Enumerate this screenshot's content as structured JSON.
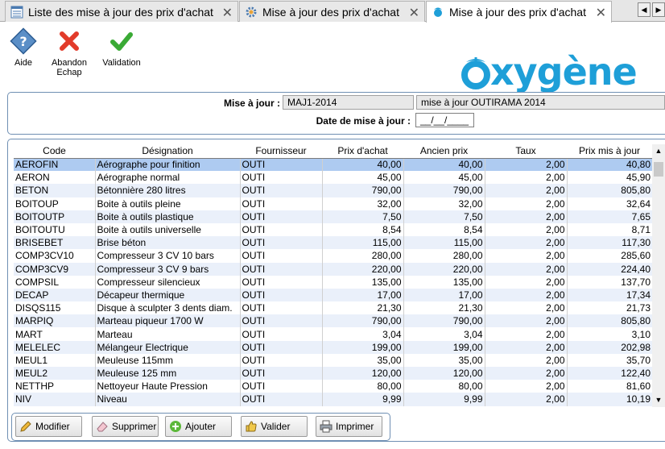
{
  "tabs": [
    {
      "label": "Liste des mise à jour des prix d'achat",
      "active": false,
      "icon": "list-icon"
    },
    {
      "label": "Mise à jour des prix d'achat",
      "active": false,
      "icon": "gear-icon"
    },
    {
      "label": "Mise à jour des prix d'achat",
      "active": true,
      "icon": "oxygene-icon"
    }
  ],
  "toolbar": {
    "aide": "Aide",
    "abandon_line1": "Abandon",
    "abandon_line2": "Echap",
    "validation": "Validation"
  },
  "logo": {
    "text": "xygène",
    "color": "#1e9fd8"
  },
  "header": {
    "mise_a_jour_label": "Mise à jour :",
    "mise_a_jour_code": "MAJ1-2014",
    "mise_a_jour_desc": "mise à jour OUTIRAMA 2014",
    "date_label": "Date de mise à jour :",
    "date_value": "__/__/____"
  },
  "grid": {
    "columns": [
      "Code",
      "Désignation",
      "Fournisseur",
      "Prix d'achat",
      "Ancien prix",
      "Taux",
      "Prix mis à jour"
    ],
    "selected_row": 0,
    "rows": [
      [
        "AEROFIN",
        "Aérographe pour finition",
        "OUTI",
        "40,00",
        "40,00",
        "2,00",
        "40,80"
      ],
      [
        "AERON",
        "Aérographe normal",
        "OUTI",
        "45,00",
        "45,00",
        "2,00",
        "45,90"
      ],
      [
        "BETON",
        "Bétonnière 280 litres",
        "OUTI",
        "790,00",
        "790,00",
        "2,00",
        "805,80"
      ],
      [
        "BOITOUP",
        "Boite à outils pleine",
        "OUTI",
        "32,00",
        "32,00",
        "2,00",
        "32,64"
      ],
      [
        "BOITOUTP",
        "Boite à outils plastique",
        "OUTI",
        "7,50",
        "7,50",
        "2,00",
        "7,65"
      ],
      [
        "BOITOUTU",
        "Boite à outils universelle",
        "OUTI",
        "8,54",
        "8,54",
        "2,00",
        "8,71"
      ],
      [
        "BRISEBET",
        "Brise béton",
        "OUTI",
        "115,00",
        "115,00",
        "2,00",
        "117,30"
      ],
      [
        "COMP3CV10",
        "Compresseur 3 CV 10 bars",
        "OUTI",
        "280,00",
        "280,00",
        "2,00",
        "285,60"
      ],
      [
        "COMP3CV9",
        "Compresseur 3 CV 9 bars",
        "OUTI",
        "220,00",
        "220,00",
        "2,00",
        "224,40"
      ],
      [
        "COMPSIL",
        "Compresseur silencieux",
        "OUTI",
        "135,00",
        "135,00",
        "2,00",
        "137,70"
      ],
      [
        "DECAP",
        "Décapeur thermique",
        "OUTI",
        "17,00",
        "17,00",
        "2,00",
        "17,34"
      ],
      [
        "DISQS115",
        "Disque à sculpter 3 dents diam.",
        "OUTI",
        "21,30",
        "21,30",
        "2,00",
        "21,73"
      ],
      [
        "MARPIQ",
        "Marteau piqueur 1700 W",
        "OUTI",
        "790,00",
        "790,00",
        "2,00",
        "805,80"
      ],
      [
        "MART",
        "Marteau",
        "OUTI",
        "3,04",
        "3,04",
        "2,00",
        "3,10"
      ],
      [
        "MELELEC",
        "Mélangeur Electrique",
        "OUTI",
        "199,00",
        "199,00",
        "2,00",
        "202,98"
      ],
      [
        "MEUL1",
        "Meuleuse 115mm",
        "OUTI",
        "35,00",
        "35,00",
        "2,00",
        "35,70"
      ],
      [
        "MEUL2",
        "Meuleuse 125 mm",
        "OUTI",
        "120,00",
        "120,00",
        "2,00",
        "122,40"
      ],
      [
        "NETTHP",
        "Nettoyeur Haute Pression",
        "OUTI",
        "80,00",
        "80,00",
        "2,00",
        "81,60"
      ],
      [
        "NIV",
        "Niveau",
        "OUTI",
        "9,99",
        "9,99",
        "2,00",
        "10,19"
      ]
    ]
  },
  "buttons": {
    "modifier": "Modifier",
    "supprimer": "Supprimer",
    "ajouter": "Ajouter",
    "valider": "Valider",
    "imprimer": "Imprimer"
  },
  "colors": {
    "accent": "#1e9fd8",
    "selected_row": "#aecbf1",
    "alt_row": "#eaf0fa",
    "panel_border": "#6f8fb3",
    "abandon_red": "#e23b2a",
    "validation_green": "#3aaa35"
  }
}
